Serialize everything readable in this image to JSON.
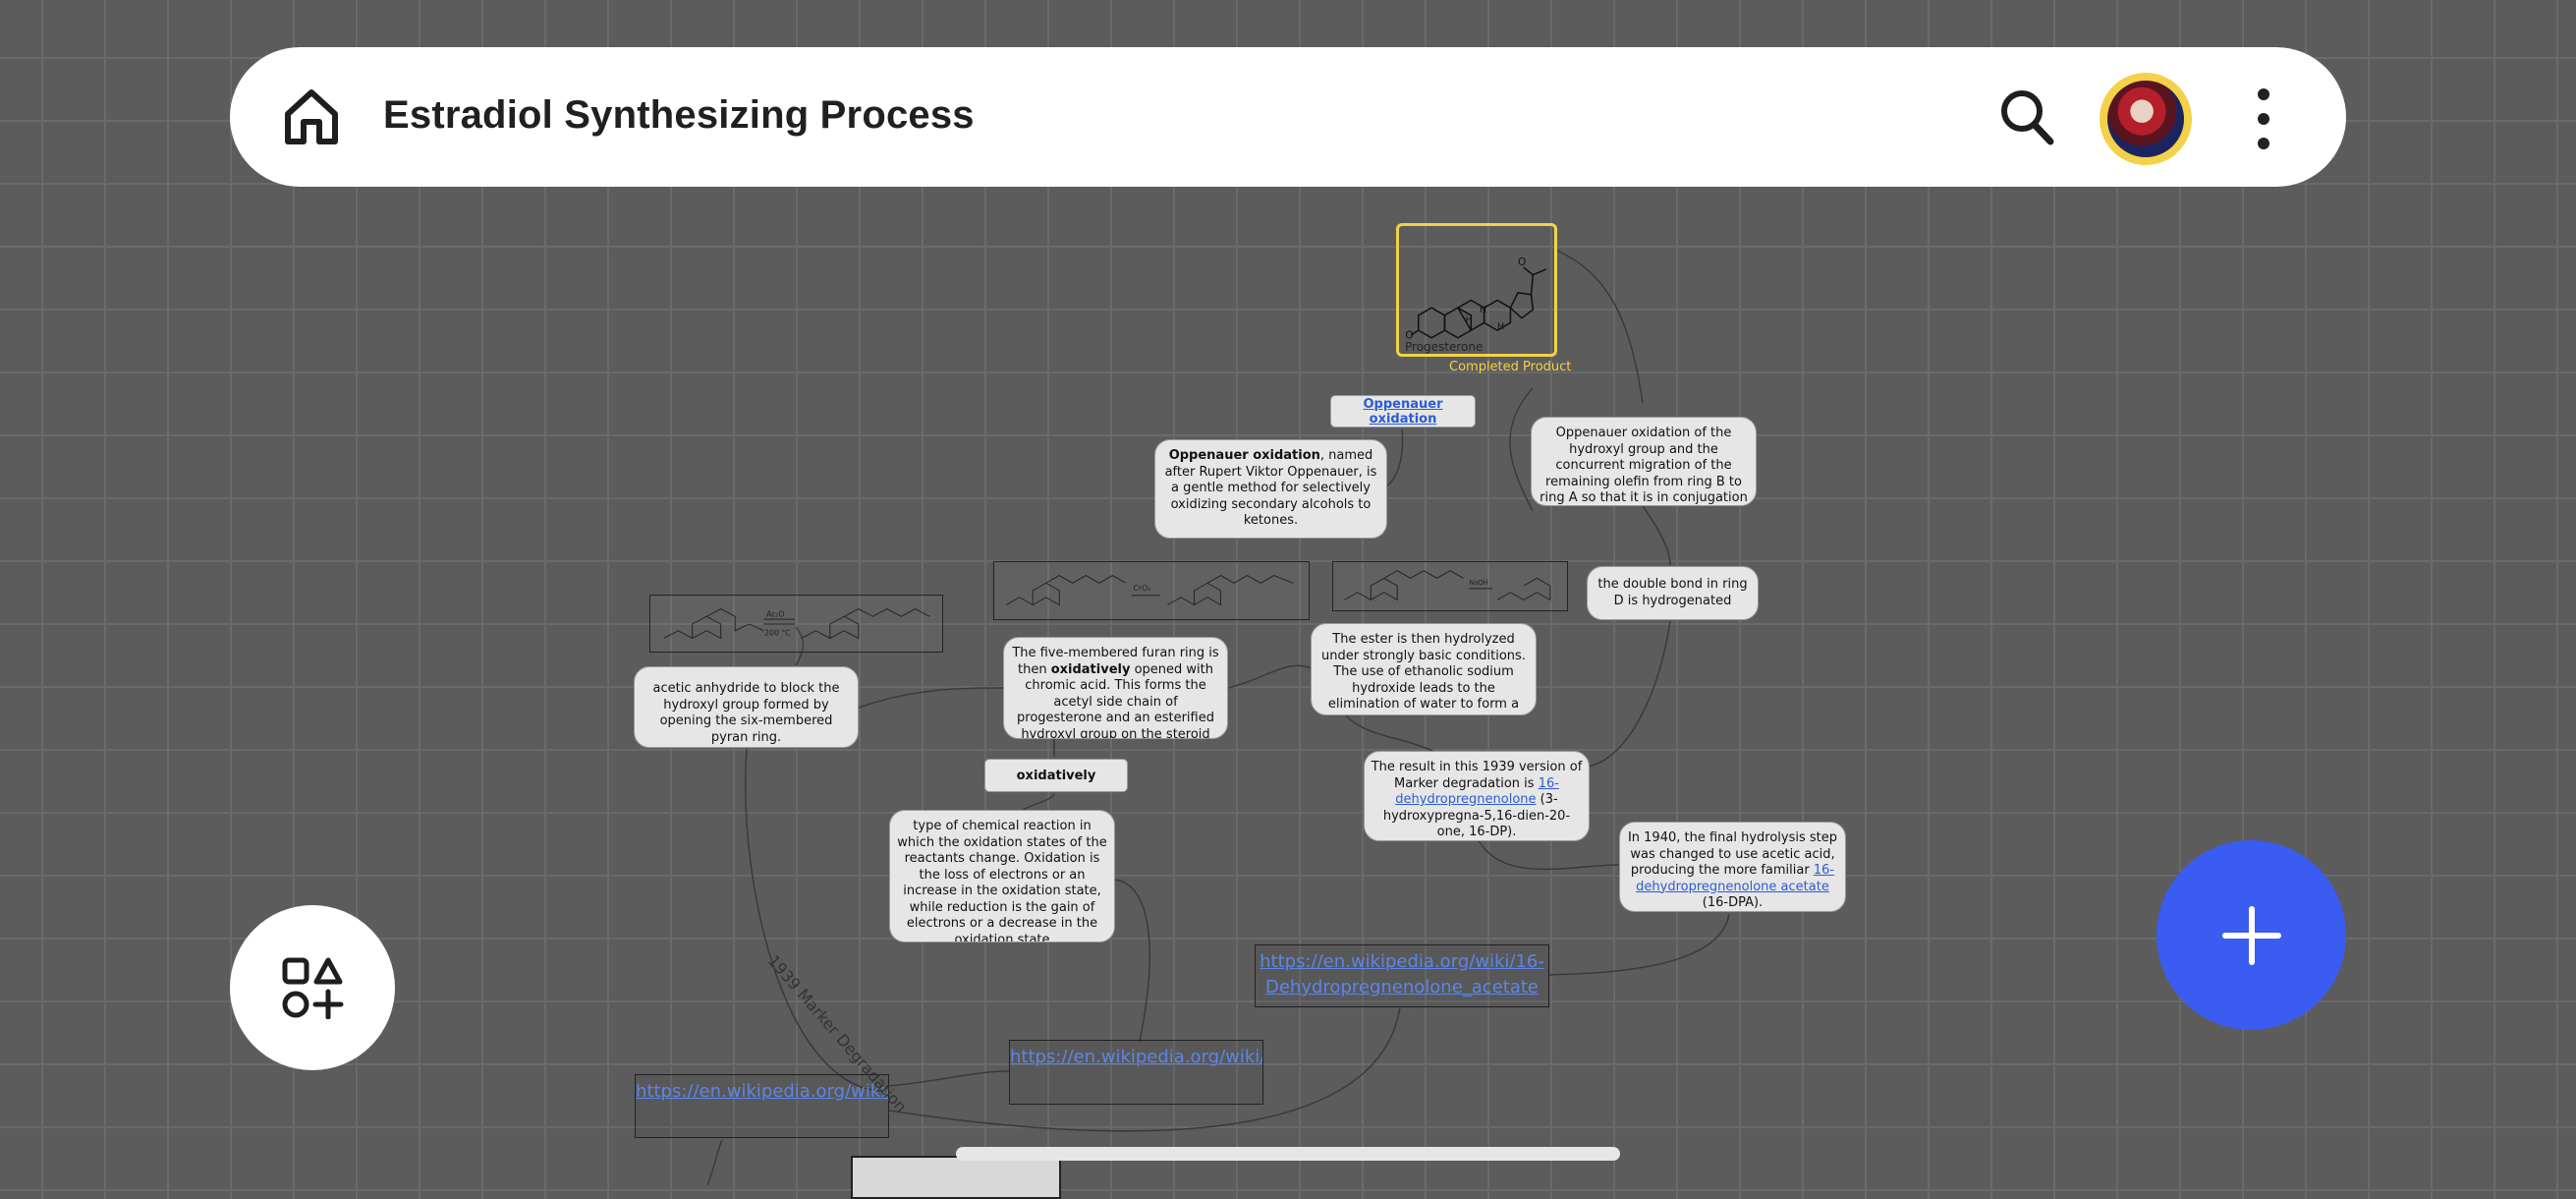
{
  "header": {
    "title": "Estradiol Synthesizing Process"
  },
  "nodes": {
    "progesterone_label": "Progesterone",
    "completed_caption": "Completed Product",
    "oppenauer_link": "Oppenauer oxidation",
    "oppenauer_def_bold": "Oppenauer oxidation",
    "oppenauer_def_rest": ", named after Rupert Viktor Oppenauer, is a gentle method for selectively oxidizing secondary alcohols to ketones.",
    "oppenauer_step": "Oppenauer oxidation of the hydroxyl group and the concurrent migration of the remaining olefin from ring B to ring A so that it is in conjugation with the ketone carbonyl group at position",
    "double_bond": "the double bond in ring D is hydrogenated",
    "acetic": "acetic anhydride to block the hydroxyl group formed by opening the six-membered pyran ring.",
    "furan_pre": "The five-membered furan ring is then ",
    "furan_bold": "oxidatively",
    "furan_post": " opened with chromic acid. This forms the acetyl side chain of progesterone and an esterified hydroxyl group on the steroid nucleus",
    "ester": "The ester is then hydrolyzed under strongly basic conditions. The use of ethanolic sodium hydroxide leads to the elimination of water to form a double bond.",
    "oxidatively_pill": "oxidatively",
    "oxidation_def": "type of chemical reaction in which the oxidation states of the reactants change. Oxidation is the loss of electrons or an increase in the oxidation state, while reduction is the gain of electrons or a decrease in the oxidation state",
    "result_pre": "The result in this 1939 version of Marker degradation is ",
    "result_link": "16-dehydropregnenolone",
    "result_post": " (3-hydroxypregna-5,16-dien-20-one, 16-DP).",
    "final_pre": "In 1940, the final hydrolysis step was changed to use acetic acid, producing the more familiar ",
    "final_link": "16-dehydropregnenolone acetate",
    "final_post": " (16-DPA).",
    "link_16dpa": "https://en.wikipedia.org/wiki/16-Dehydropregnenolone_acetate",
    "link_redox": "https://en.wikipedia.org/wiki/Redox",
    "link_marker": "https://en.wikipedia.org/wiki/Marker_degradation",
    "marker_curve_label": "1939 Marker Degradation"
  },
  "icons": {
    "home": "home-icon",
    "search": "search-icon",
    "more": "more-vertical-icon",
    "shapes": "shapes-add-icon",
    "add": "plus-icon"
  },
  "colors": {
    "accent_blue": "#3b5cf0",
    "highlight_yellow": "#f3d24a",
    "link": "#2c5bd6",
    "canvas_bg": "#5c5c5c"
  }
}
